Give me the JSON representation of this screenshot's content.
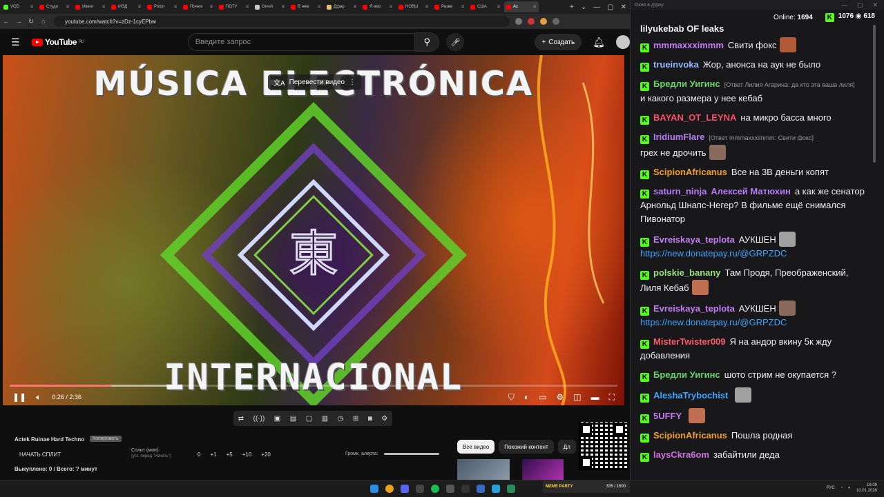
{
  "browser": {
    "tabs": [
      {
        "label": "VOD",
        "color": "#53fc18"
      },
      {
        "label": "Студи",
        "color": "#ff0000"
      },
      {
        "label": "Ивент",
        "color": "#ff0000"
      },
      {
        "label": "МЭД",
        "color": "#ff0000"
      },
      {
        "label": "Polon",
        "color": "#ff0000"
      },
      {
        "label": "Почем",
        "color": "#ff0000"
      },
      {
        "label": "ПОТУ",
        "color": "#ff0000"
      },
      {
        "label": "Oresh",
        "color": "#cccccc"
      },
      {
        "label": "В нем",
        "color": "#ff0000"
      },
      {
        "label": "Дфар",
        "color": "#e8c07a"
      },
      {
        "label": "Я вмо",
        "color": "#ff0000"
      },
      {
        "label": "НОВЫ",
        "color": "#ff0000"
      },
      {
        "label": "Разве",
        "color": "#ff0000"
      },
      {
        "label": "США",
        "color": "#ff0000"
      },
      {
        "label": "Ac",
        "color": "#ff0000",
        "active": true
      }
    ],
    "url": "youtube.com/watch?v=zDz-1cyEPbw"
  },
  "youtube": {
    "logo_text": "YouTube",
    "logo_region": "RU",
    "search_placeholder": "Введите запрос",
    "create_label": "Создать"
  },
  "video": {
    "title_top": "MÚSICA ELECTRÓNICA",
    "title_bottom": "INTERNACIONAL",
    "translate_label": "Перевести видео",
    "time": "0:26 / 2:36",
    "progress_fraction": 0.167,
    "buffered_fraction": 0.27
  },
  "toolbar_icons": [
    "loop-icon",
    "audio-icon",
    "screen-icon",
    "clip-icon",
    "frame-icon",
    "pip-icon",
    "speed-icon",
    "add-icon",
    "camera-icon",
    "settings-icon"
  ],
  "panel": {
    "title": "Actek Ruinae Hard Techno",
    "badge": "Копировать",
    "start_split": "НАЧАТЬ СПЛИТ",
    "split_label": "Сплит (мин):",
    "split_sub": "(уст. перед \"Начать\")",
    "numbers": [
      "0",
      "+1",
      "+5",
      "+10",
      "+20"
    ],
    "alert_label": "Громк. алерта:",
    "bought": "Выкуплено: 0 / Всего: ? минут"
  },
  "chips": [
    "Все видео",
    "Похожий контент",
    "Дл"
  ],
  "chat": {
    "window_title": "Окно в дурку",
    "online_label": "Online:",
    "online_value": "1694",
    "stat_a": "1076",
    "stat_b": "618",
    "messages": [
      {
        "user": "lilyukebab OF leaks",
        "color": "#efeff1",
        "text": "",
        "cut": true
      },
      {
        "user": "mmmaxxximmm",
        "color": "#c27cf5",
        "text": "Свити фокс"
      },
      {
        "user": "trueinvoka",
        "color": "#8fb7ff",
        "text": "Жор, анонса на аук не было"
      },
      {
        "user": "Бредли Уигинс",
        "color": "#6bd36b",
        "reply": "[Ответ Лилия Агарина: да кто эта ваша лиля]",
        "text": "и какого размера у нее кебаб"
      },
      {
        "user": "BAYAN_OT_LEYNA",
        "color": "#ff4d6a",
        "text": "на микро басса много"
      },
      {
        "user": "IridiumFlare",
        "color": "#b77cf5",
        "reply": "[Ответ mmmaxxximmm: Свити фокс]",
        "text": "грех не дрочить"
      },
      {
        "user": "ScipionAfricanus",
        "color": "#f0a020",
        "text": "Все на 3В деньги копят"
      },
      {
        "user": "saturn_ninja",
        "user2": "Алексей Матюхин",
        "color": "#b77cf5",
        "text": "а как же сенатор Арнольд Шнапс-Негер? В фильме ещё снимался Пивонатор"
      },
      {
        "user": "Evreiskaya_teplota",
        "color": "#c27cf5",
        "text": "АУКШЕН",
        "link": "https://new.donatepay.ru/@GRPZDC"
      },
      {
        "user": "polskie_banany",
        "color": "#9be07a",
        "text": "Там Продя, Преображенский, Лиля Кебаб"
      },
      {
        "user": "Evreiskaya_teplota",
        "color": "#c27cf5",
        "text": "АУКШЕН",
        "link": "https://new.donatepay.ru/@GRPZDC"
      },
      {
        "user": "MisterTwister009",
        "color": "#ff5a6a",
        "text": "Я на андор вкину 5к жду добавления"
      },
      {
        "user": "Бредли Уигинс",
        "color": "#6bd36b",
        "text": "шото стрим не окупается ?"
      },
      {
        "user": "AleshaTrybochist",
        "color": "#3ea6ff",
        "text": ""
      },
      {
        "user": "5UFFY",
        "color": "#c27cf5",
        "text": ""
      },
      {
        "user": "ScipionAfricanus",
        "color": "#f0a020",
        "text": "Пошла родная"
      },
      {
        "user": "laysCkra6om",
        "color": "#d070e0",
        "text": "забайтили деда"
      }
    ]
  },
  "taskbar": {
    "widget_label": "MEME PARTY",
    "widget_value": "335 / 1500",
    "lang": "РУС",
    "time": "16:09",
    "date": "10.01.2026"
  }
}
